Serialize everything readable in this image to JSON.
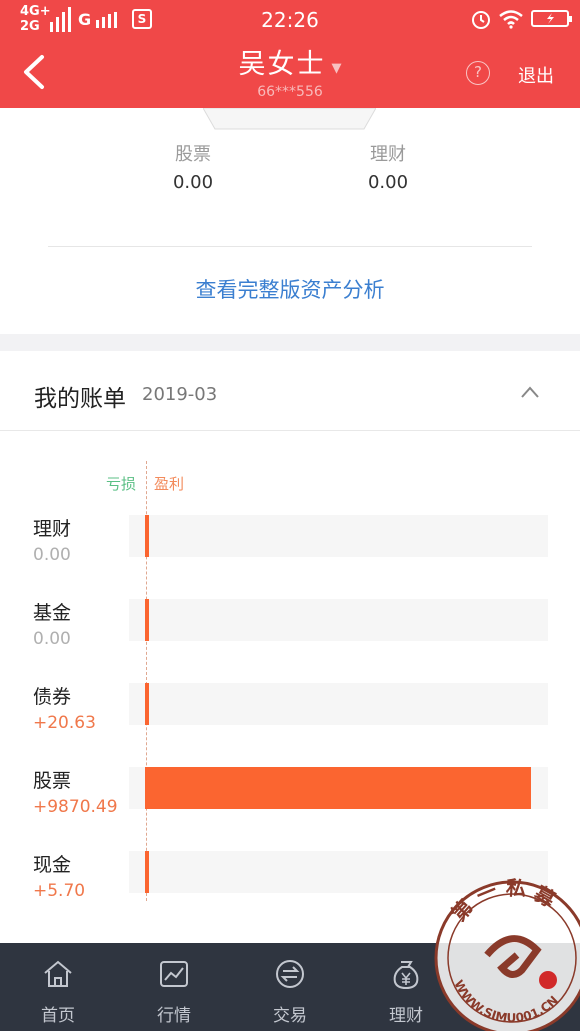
{
  "status_bar": {
    "network_top": "4G+",
    "network_bottom": "2G",
    "network_g": "G",
    "sim_icon_text": "S",
    "time": "22:26"
  },
  "header": {
    "title": "吴女士",
    "account": "66***556",
    "help_label": "?",
    "logout_label": "退出",
    "bg_color": "#f04848"
  },
  "assets": {
    "items": [
      {
        "label": "股票",
        "value": "0.00"
      },
      {
        "label": "理财",
        "value": "0.00"
      }
    ],
    "analysis_link": "查看完整版资产分析"
  },
  "bill": {
    "title": "我的账单",
    "date": "2019-03",
    "legend_loss": "亏损",
    "legend_profit": "盈利",
    "rows": [
      {
        "label": "理财",
        "value": "0.00",
        "amount": 0.0
      },
      {
        "label": "基金",
        "value": "0.00",
        "amount": 0.0
      },
      {
        "label": "债券",
        "value": "+20.63",
        "amount": 20.63
      },
      {
        "label": "股票",
        "value": "+9870.49",
        "amount": 9870.49
      },
      {
        "label": "现金",
        "value": "+5.70",
        "amount": 5.7
      }
    ],
    "profit_color": "#fb6530",
    "zero_color": "#9a9a9a",
    "positive_text_color": "#f0784b"
  },
  "bottom_nav": {
    "items": [
      {
        "label": "首页",
        "icon": "home-icon"
      },
      {
        "label": "行情",
        "icon": "market-chart-icon"
      },
      {
        "label": "交易",
        "icon": "trade-icon"
      },
      {
        "label": "理财",
        "icon": "finance-yuan-icon"
      }
    ]
  },
  "watermark": {
    "text_top": "第一私募",
    "text_bottom": "WWW.SIMU001.CN"
  }
}
